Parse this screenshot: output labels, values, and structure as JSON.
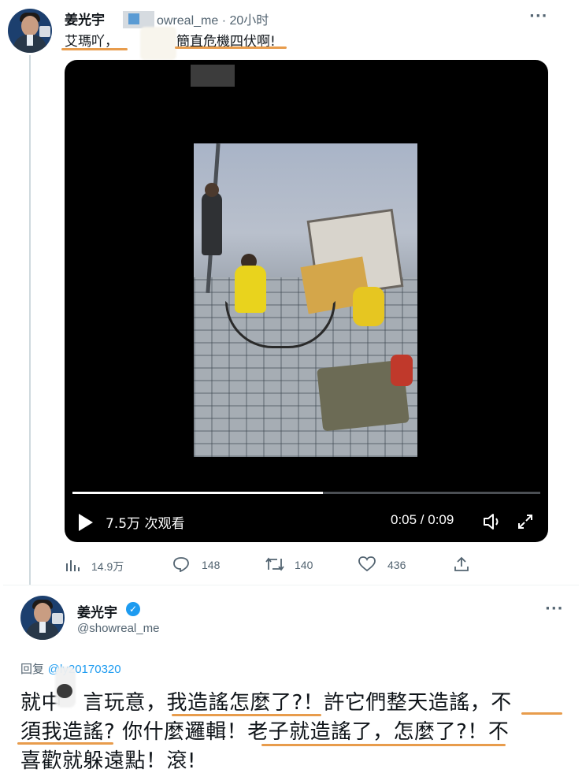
{
  "top_tweet": {
    "author_name": "姜光宇",
    "handle_partial": "owreal_me · 20小时",
    "text_part1": "艾瑪吖，",
    "text_part2": "簡直危機四伏啊!",
    "more_label": "···",
    "video": {
      "views": "7.5万 次观看",
      "time": "0:05 / 0:09",
      "progress": 0.535
    },
    "stats": {
      "views": "14.9万",
      "replies": "148",
      "retweets": "140",
      "likes": "436"
    }
  },
  "reply_tweet": {
    "author_name": "姜光宇",
    "handle": "@showreal_me",
    "more_label": "···",
    "reply_prefix": "回复",
    "reply_mention": "@ly20170320",
    "lines": [
      "就中　言玩意，我造謠怎麼了?！許它們整天造謠，不",
      "須我造謠? 你什麼邏輯！老子就造謠了，怎麼了?！不",
      "喜歡就躲遠點！滾!"
    ]
  },
  "colors": {
    "accent_blue": "#1d9bf0",
    "underline_orange": "#e89c4c",
    "muted": "#536471"
  }
}
